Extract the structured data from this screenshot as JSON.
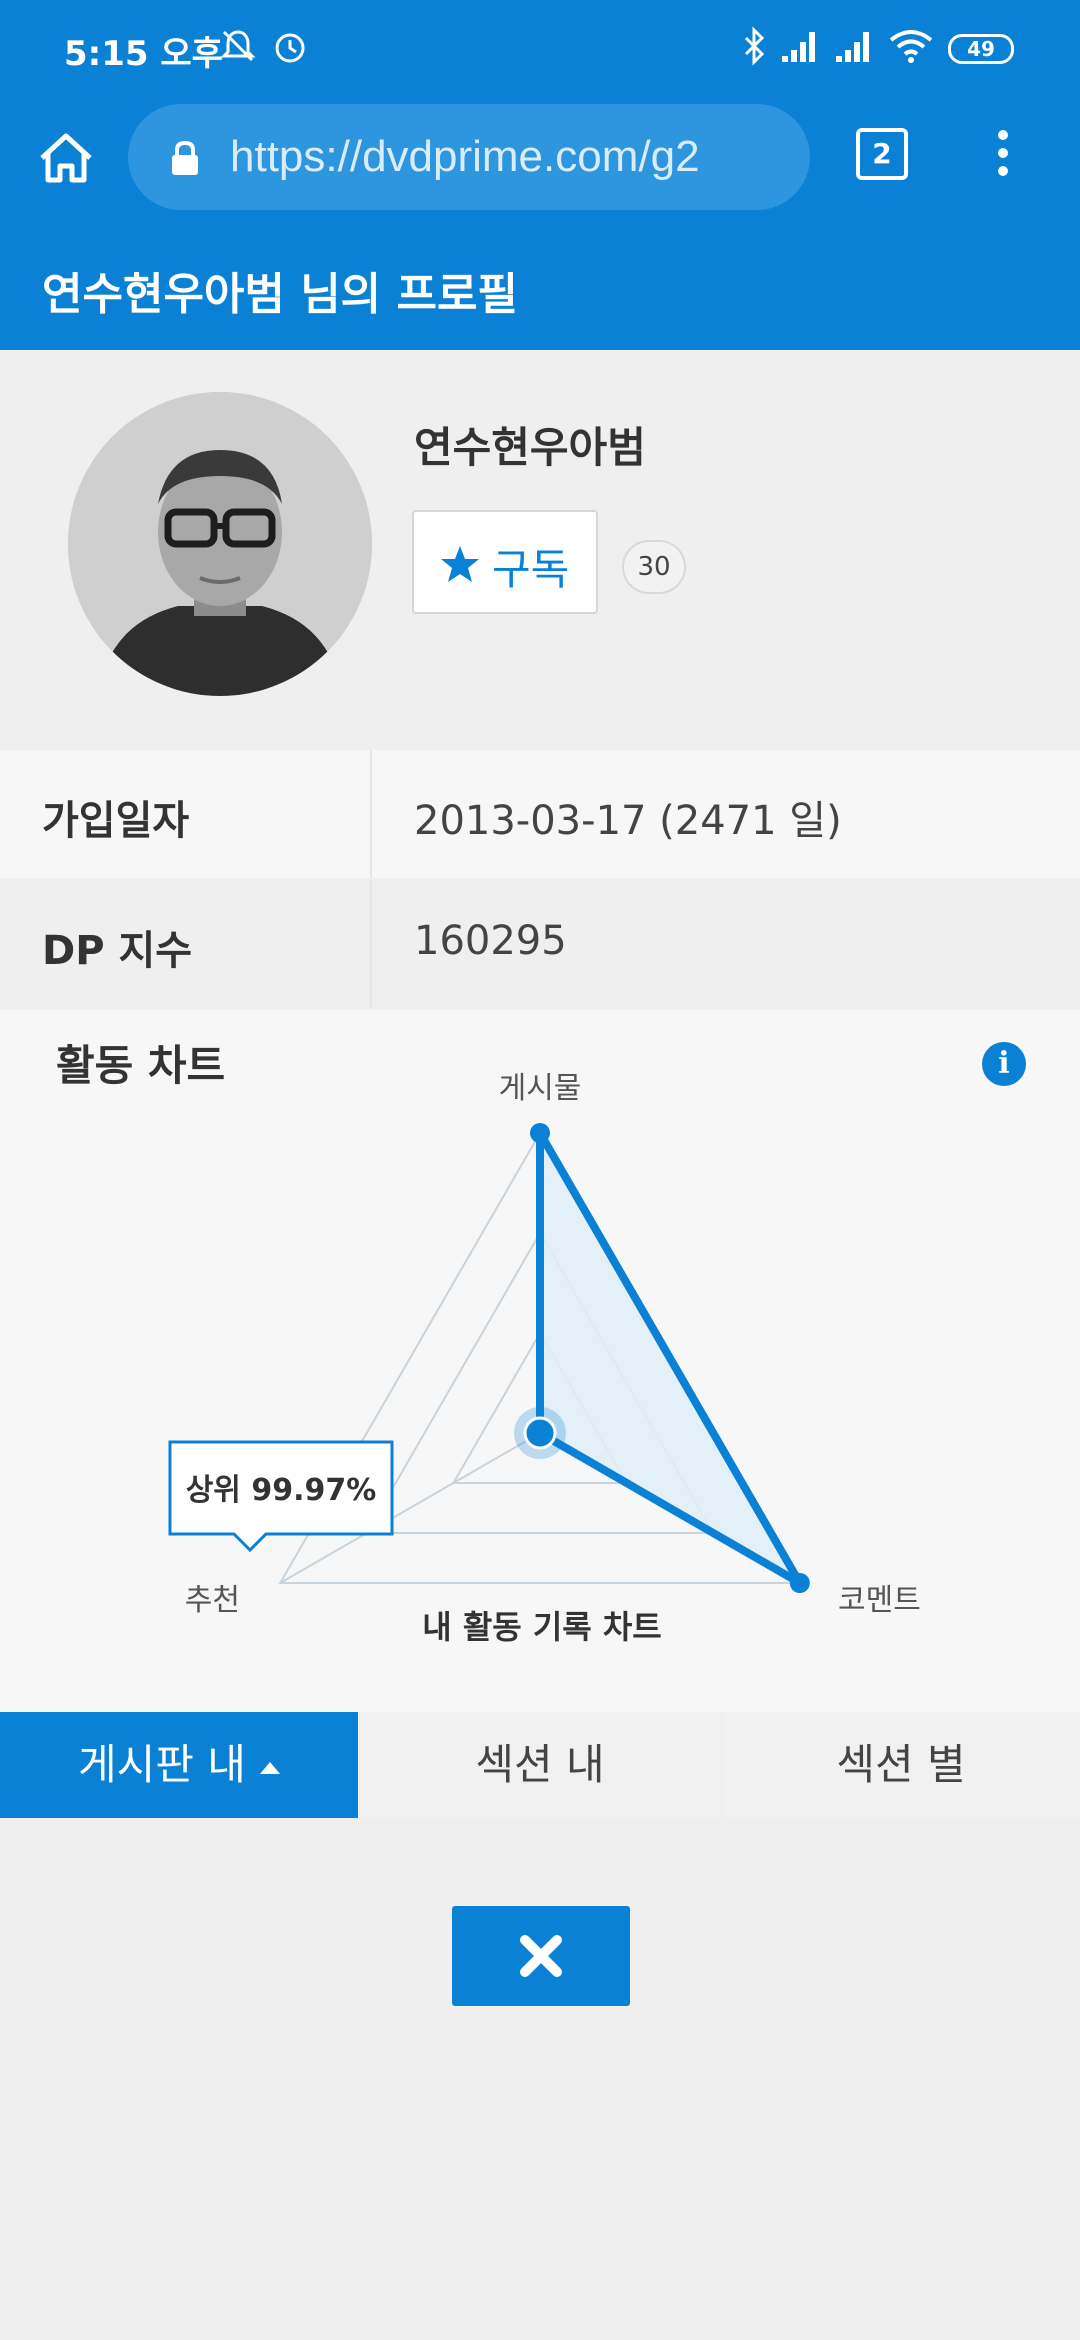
{
  "status_bar": {
    "time": "5:15 오후",
    "battery": "49",
    "icons": [
      "mute-icon",
      "alarm-icon",
      "bluetooth-icon",
      "signal-icon",
      "signal-icon",
      "wifi-icon",
      "battery-icon"
    ]
  },
  "browser": {
    "url": "https://dvdprime.com/g2",
    "tab_count": "2"
  },
  "header": {
    "title": "연수현우아범 님의 프로필"
  },
  "profile": {
    "username": "연수현우아범",
    "subscribe_label": "구독",
    "subscriber_count": "30"
  },
  "info": {
    "join_label": "가입일자",
    "join_value": "2013-03-17 (2471 일)",
    "dp_label": "DP 지수",
    "dp_value": "160295"
  },
  "activity": {
    "title": "활동 차트",
    "info_glyph": "i"
  },
  "chart_data": {
    "type": "radar",
    "axes": [
      "게시물",
      "코멘트",
      "추천"
    ],
    "values": [
      1.0,
      1.0,
      0.0
    ],
    "title": "내 활동 기록 차트",
    "tooltip": "상위 99.97%",
    "colors": {
      "line": "#0a81d4",
      "fill": "#dfeef8",
      "grid": "#c7d4dd"
    }
  },
  "tabs": [
    {
      "label": "게시판 내",
      "active": true
    },
    {
      "label": "섹션 내",
      "active": false
    },
    {
      "label": "섹션 별",
      "active": false
    }
  ],
  "colors": {
    "accent": "#0a81d4",
    "background": "#efefef"
  }
}
